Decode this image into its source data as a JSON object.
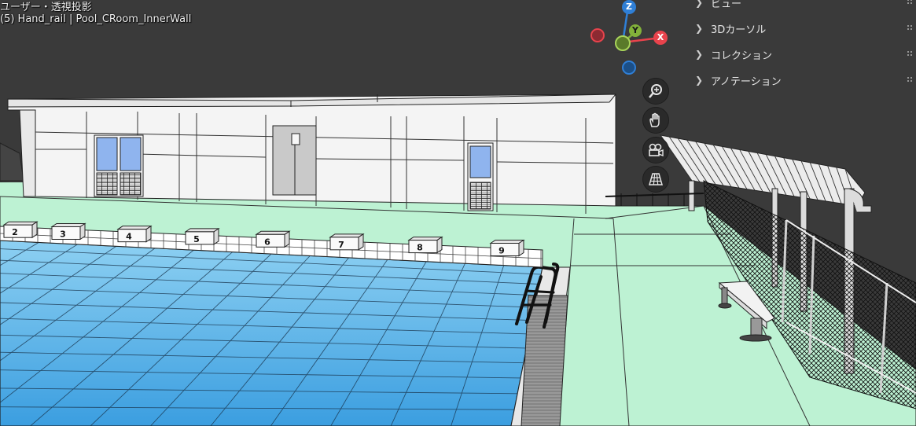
{
  "viewport": {
    "view_mode": "ユーザー・透視投影",
    "active_object": "(5) Hand_rail | Pool_CRoom_InnerWall"
  },
  "gizmo": {
    "z_label": "Z",
    "y_label": "Y",
    "x_label": "X",
    "colors": {
      "x": "#e8434c",
      "y": "#82b23a",
      "z": "#2f7fd6"
    }
  },
  "nav_buttons": [
    {
      "icon": "zoom-icon"
    },
    {
      "icon": "hand-pan-icon"
    },
    {
      "icon": "camera-icon"
    },
    {
      "icon": "grid-perspective-icon"
    }
  ],
  "sidebar_panels": [
    {
      "label": "ビュー"
    },
    {
      "label": "3Dカーソル"
    },
    {
      "label": "コレクション"
    },
    {
      "label": "アノテーション"
    }
  ],
  "starting_blocks": [
    "2",
    "3",
    "4",
    "5",
    "6",
    "7",
    "8",
    "9"
  ],
  "scene_colors": {
    "background": "#3a3a3a",
    "pool_water": "#5fb4e6",
    "deck": "#bdf2d3",
    "building": "#f4f4f4",
    "window": "#8fb4ee"
  }
}
